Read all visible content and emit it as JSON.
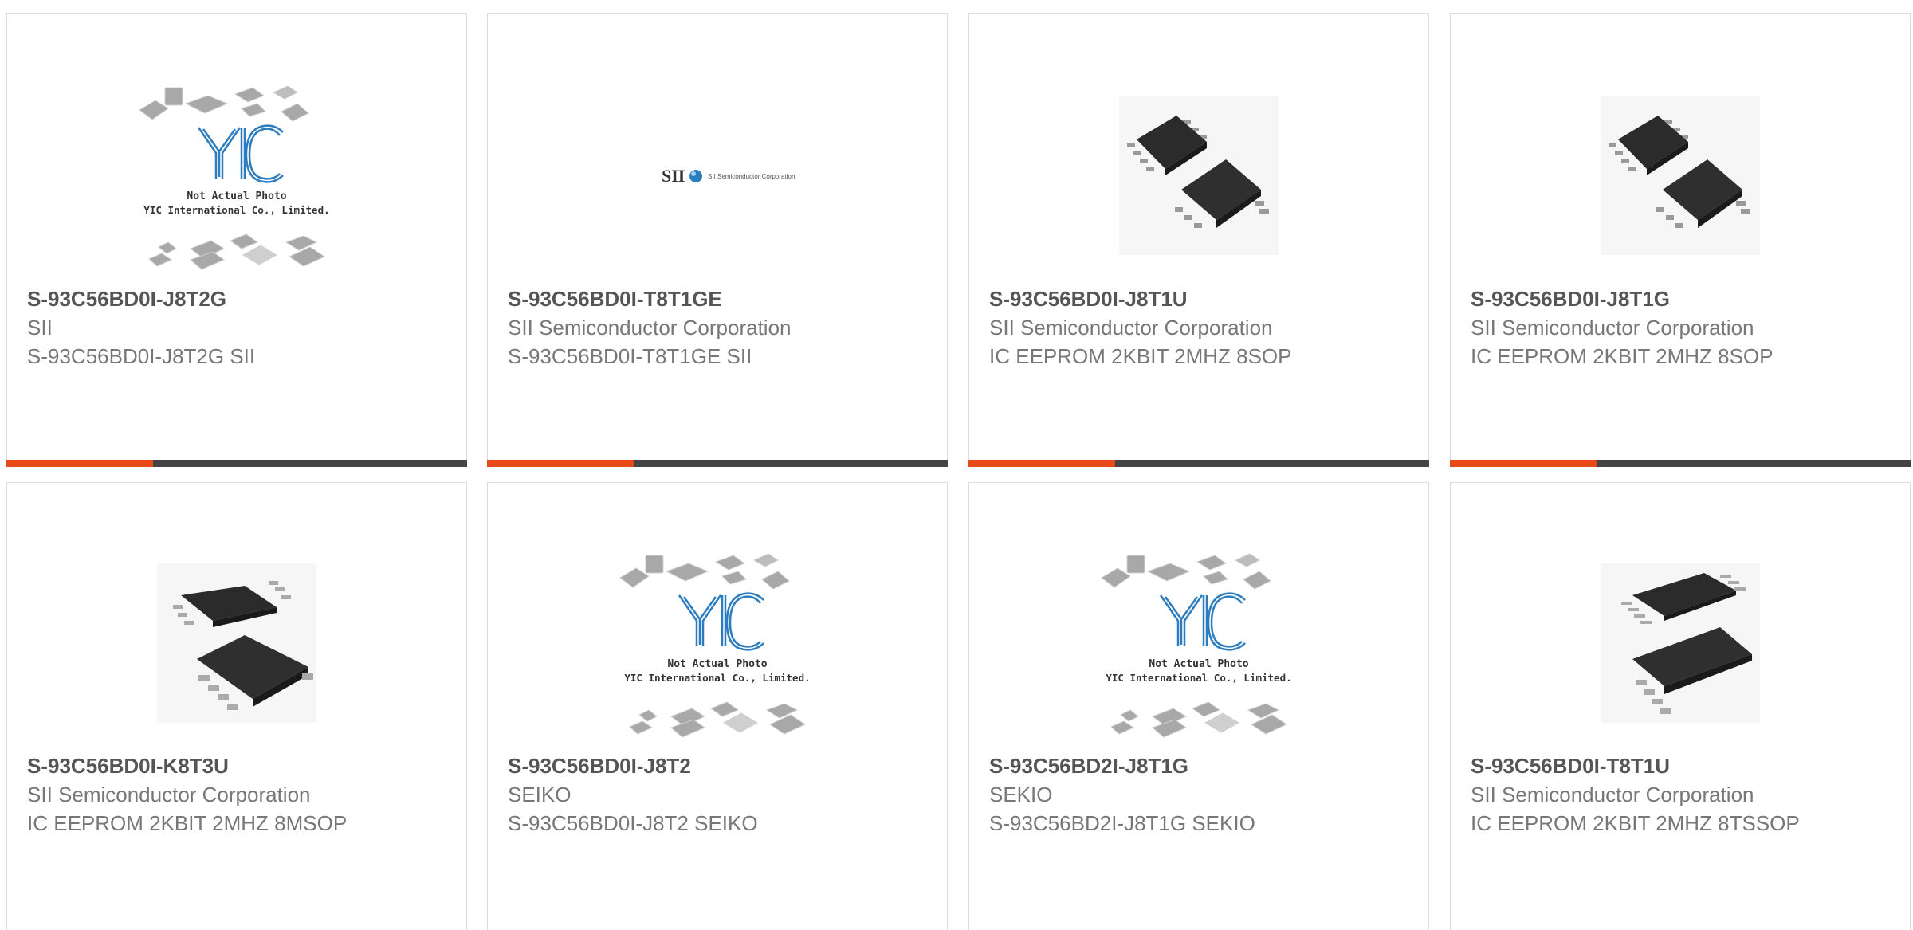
{
  "colors": {
    "accent": "#e84a1a",
    "bar_dark": "#444444",
    "title_text": "#555555",
    "body_text": "#777777",
    "yic_blue": "#2c7dbf",
    "chip_dark": "#2d2d2d"
  },
  "products": [
    {
      "part": "S-93C56BD0I-J8T2G",
      "maker": "SII",
      "desc": "S-93C56BD0I-J8T2G SII",
      "image": "yic-placeholder-icon",
      "placeholder_line1": "Not Actual Photo",
      "placeholder_line2": "YIC International Co., Limited."
    },
    {
      "part": "S-93C56BD0I-T8T1GE",
      "maker": "SII Semiconductor Corporation",
      "desc": "S-93C56BD0I-T8T1GE SII",
      "image": "sii-logo-icon",
      "logo_text": "SII",
      "logo_sub": "SII Semiconductor Corporation"
    },
    {
      "part": "S-93C56BD0I-J8T1U",
      "maker": "SII Semiconductor Corporation",
      "desc": "IC EEPROM 2KBIT 2MHZ 8SOP",
      "image": "sop8-chip-icon"
    },
    {
      "part": "S-93C56BD0I-J8T1G",
      "maker": "SII Semiconductor Corporation",
      "desc": "IC EEPROM 2KBIT 2MHZ 8SOP",
      "image": "sop8-chip-icon"
    },
    {
      "part": "S-93C56BD0I-K8T3U",
      "maker": "SII Semiconductor Corporation",
      "desc": "IC EEPROM 2KBIT 2MHZ 8MSOP",
      "image": "msop8-chip-icon"
    },
    {
      "part": "S-93C56BD0I-J8T2",
      "maker": "SEIKO",
      "desc": "S-93C56BD0I-J8T2 SEIKO",
      "image": "yic-placeholder-icon",
      "placeholder_line1": "Not Actual Photo",
      "placeholder_line2": "YIC International Co., Limited."
    },
    {
      "part": "S-93C56BD2I-J8T1G",
      "maker": "SEKIO",
      "desc": "S-93C56BD2I-J8T1G SEKIO",
      "image": "yic-placeholder-icon",
      "placeholder_line1": "Not Actual Photo",
      "placeholder_line2": "YIC International Co., Limited."
    },
    {
      "part": "S-93C56BD0I-T8T1U",
      "maker": "SII Semiconductor Corporation",
      "desc": "IC EEPROM 2KBIT 2MHZ 8TSSOP",
      "image": "tssop8-chip-icon"
    }
  ]
}
